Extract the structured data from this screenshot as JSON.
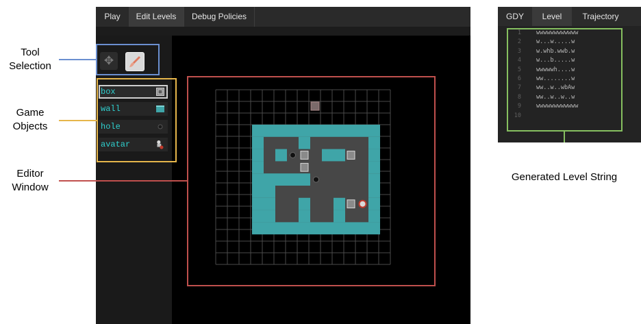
{
  "tabs": [
    "Play",
    "Edit Levels",
    "Debug Policies"
  ],
  "active_tab": "Edit Levels",
  "game_objects": [
    {
      "label": "box",
      "icon": "box-icon",
      "selected": true
    },
    {
      "label": "wall",
      "icon": "wall-icon",
      "selected": false
    },
    {
      "label": "hole",
      "icon": "hole-icon",
      "selected": false
    },
    {
      "label": "avatar",
      "icon": "avatar-icon",
      "selected": false
    }
  ],
  "tools": [
    "move-icon",
    "paintbrush-icon"
  ],
  "level_tabs": [
    "GDY",
    "Level",
    "Trajectory"
  ],
  "active_level_tab": "Level",
  "level_lines": [
    {
      "n": "1",
      "text": "wwwwwwwwwwww"
    },
    {
      "n": "2",
      "text": "w...w.....w"
    },
    {
      "n": "3",
      "text": "w.whb.wwb.w"
    },
    {
      "n": "4",
      "text": "w...b.....w"
    },
    {
      "n": "5",
      "text": "wwwwwh....w"
    },
    {
      "n": "6",
      "text": "ww........w"
    },
    {
      "n": "7",
      "text": "ww..w..wbAw"
    },
    {
      "n": "8",
      "text": "ww..w..w..w"
    },
    {
      "n": "9",
      "text": "wwwwwwwwwwww"
    },
    {
      "n": "10",
      "text": ""
    }
  ],
  "annotations": {
    "tool_selection": "Tool\nSelection",
    "game_objects": "Game\nObjects",
    "editor_window": "Editor\nWindow",
    "level_string": "Generated Level String"
  },
  "colors": {
    "tool_selection": "#6b8fd0",
    "game_objects": "#e6b64b",
    "editor_window": "#c0504d",
    "level_string": "#86c060",
    "wall": "#3fa5a8",
    "object_text": "#2fd0cf"
  }
}
